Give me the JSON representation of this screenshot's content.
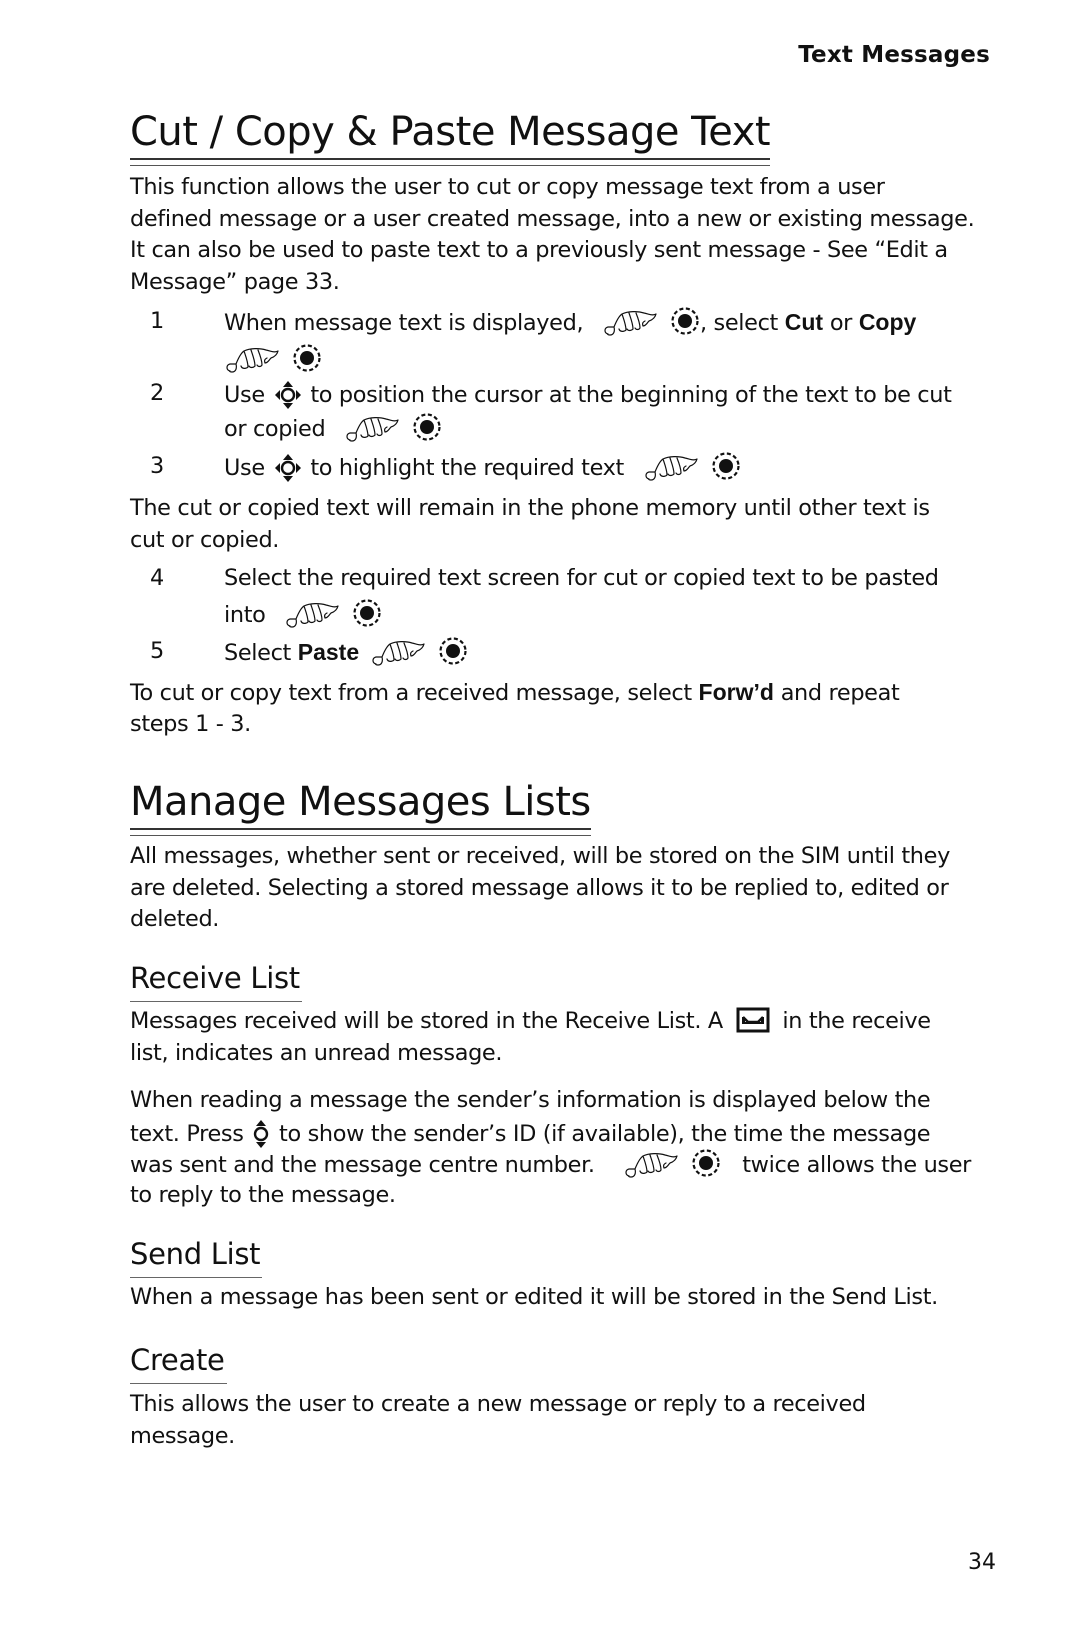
{
  "running_head": "Text Messages",
  "page_number": "34",
  "icons": {
    "hand": "menu-key-hand-icon",
    "ok": "select-key-icon",
    "nav4": "four-way-navigation-key-icon",
    "nav2": "up-down-navigation-key-icon",
    "envelope": "unread-envelope-icon"
  },
  "section1": {
    "title": "Cut / Copy & Paste Message Text",
    "intro_lines": [
      "This function allows the user to cut or copy message text from a user",
      "defined message or a user created message, into a new or existing message.",
      "It can also be used to paste text to a previously sent message - See “Edit a",
      "Message” page 33."
    ],
    "steps": [
      {
        "num": "1",
        "text_a": "When message text is displayed,",
        "text_b": ", select ",
        "bold1": "Cut",
        "text_c": " or ",
        "bold2": "Copy"
      },
      {
        "num": "2",
        "text_a": "Use",
        "text_b": "to position the cursor at the beginning of the text to be cut",
        "text_c": "or copied"
      },
      {
        "num": "3",
        "text_a": "Use",
        "text_b": "to highlight the required text"
      }
    ],
    "note_lines": [
      "The cut or copied text will remain in the phone memory until other text is",
      "cut or copied."
    ],
    "steps2": [
      {
        "num": "4",
        "text_a": "Select the required text screen for cut or copied text to be pasted",
        "text_b": "into"
      },
      {
        "num": "5",
        "text_a": "Select ",
        "bold": "Paste"
      }
    ],
    "outro": {
      "line1_a": "To cut or copy text from a received message, select ",
      "line1_bold": "Forw’d",
      "line1_b": " and repeat",
      "line2": "steps 1 - 3."
    }
  },
  "section2": {
    "title": "Manage Messages Lists",
    "intro_lines": [
      "All messages, whether sent or received, will be stored on the SIM until they",
      "are deleted. Selecting a stored message allows it to be replied to, edited or",
      "deleted."
    ],
    "subsections": {
      "receive": {
        "title": "Receive List",
        "p1_a": "Messages received will be stored in the Receive List. A",
        "p1_b": "in the receive",
        "p1_line2": "list, indicates an unread message.",
        "p2_line1": "When reading a message the sender’s information is displayed below the",
        "p2_line2_a": "text. Press",
        "p2_line2_b": "to show the sender’s ID (if available), the time the message",
        "p2_line3_a": "was sent and the message centre number.",
        "p2_line3_b": "twice allows the user",
        "p2_line4": "to reply to the message."
      },
      "send": {
        "title": "Send List",
        "text": "When a message has been sent or edited it will be stored in the Send List."
      },
      "create": {
        "title": "Create",
        "lines": [
          "This allows the user to create a new message or reply to a received",
          "message."
        ]
      }
    }
  }
}
